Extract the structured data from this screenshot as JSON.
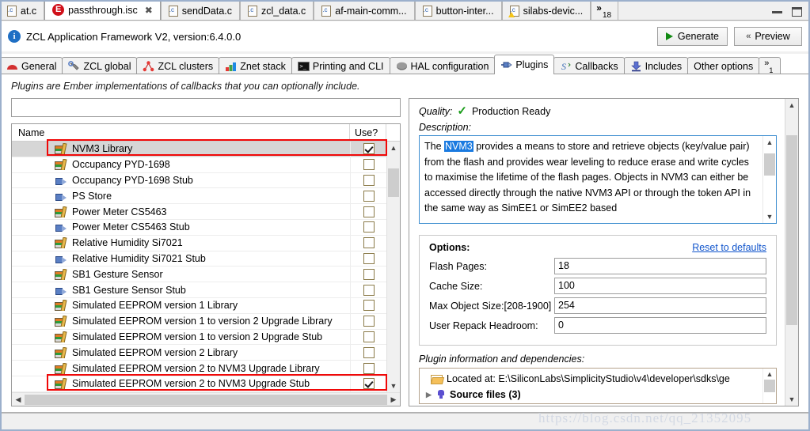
{
  "window": {
    "minimize_label": "minimize",
    "maximize_label": "maximize"
  },
  "editor_tabs": [
    {
      "label": "at.c",
      "icon": "c-file-icon",
      "active": false,
      "closable": false,
      "warn": false
    },
    {
      "label": "passthrough.isc",
      "icon": "ember-isc-icon",
      "active": true,
      "closable": true,
      "warn": false
    },
    {
      "label": "sendData.c",
      "icon": "c-file-icon",
      "active": false,
      "closable": false,
      "warn": false
    },
    {
      "label": "zcl_data.c",
      "icon": "c-file-icon",
      "active": false,
      "closable": false,
      "warn": false
    },
    {
      "label": "af-main-comm...",
      "icon": "c-file-icon",
      "active": false,
      "closable": false,
      "warn": false
    },
    {
      "label": "button-inter...",
      "icon": "c-file-icon",
      "active": false,
      "closable": false,
      "warn": false
    },
    {
      "label": "silabs-devic...",
      "icon": "c-file-warning-icon",
      "active": false,
      "closable": false,
      "warn": true
    }
  ],
  "editor_tabs_overflow": {
    "chevron": "»",
    "count": "18"
  },
  "header": {
    "icon": "info-icon",
    "title": "ZCL Application Framework V2, version:6.4.0.0",
    "generate_label": "Generate",
    "preview_label": "Preview"
  },
  "section_tabs": [
    {
      "label": "General",
      "icon": "red-semicircle-icon",
      "active": false
    },
    {
      "label": "ZCL global",
      "icon": "wrench-icon",
      "active": false
    },
    {
      "label": "ZCL clusters",
      "icon": "cluster-icon",
      "active": false
    },
    {
      "label": "Znet stack",
      "icon": "stack-icon",
      "active": false
    },
    {
      "label": "Printing and CLI",
      "icon": "console-icon",
      "active": false
    },
    {
      "label": "HAL configuration",
      "icon": "chip-icon",
      "active": false
    },
    {
      "label": "Plugins",
      "icon": "plugin-icon",
      "active": true
    },
    {
      "label": "Callbacks",
      "icon": "callback-icon",
      "active": false
    },
    {
      "label": "Includes",
      "icon": "includes-icon",
      "active": false
    },
    {
      "label": "Other options",
      "icon": "",
      "active": false
    }
  ],
  "section_tabs_overflow": {
    "chevron": "»",
    "count": "1"
  },
  "plugins_panel": {
    "intro": "Plugins are Ember implementations of callbacks that you can optionally include.",
    "filter_value": "",
    "filter_placeholder": "",
    "columns": {
      "name": "Name",
      "use": "Use?"
    },
    "rows": [
      {
        "name": "NVM3 Library",
        "icon": "library-icon",
        "checked": true,
        "selected": true,
        "highlighted": true
      },
      {
        "name": "Occupancy PYD-1698",
        "icon": "library-icon",
        "checked": false,
        "selected": false,
        "highlighted": false
      },
      {
        "name": "Occupancy PYD-1698 Stub",
        "icon": "stub-icon",
        "checked": false,
        "selected": false,
        "highlighted": false
      },
      {
        "name": "PS Store",
        "icon": "stub-icon",
        "checked": false,
        "selected": false,
        "highlighted": false
      },
      {
        "name": "Power Meter CS5463",
        "icon": "library-icon",
        "checked": false,
        "selected": false,
        "highlighted": false
      },
      {
        "name": "Power Meter CS5463 Stub",
        "icon": "stub-icon",
        "checked": false,
        "selected": false,
        "highlighted": false
      },
      {
        "name": "Relative Humidity Si7021",
        "icon": "library-icon",
        "checked": false,
        "selected": false,
        "highlighted": false
      },
      {
        "name": "Relative Humidity Si7021 Stub",
        "icon": "stub-icon",
        "checked": false,
        "selected": false,
        "highlighted": false
      },
      {
        "name": "SB1 Gesture Sensor",
        "icon": "library-icon",
        "checked": false,
        "selected": false,
        "highlighted": false
      },
      {
        "name": "SB1 Gesture Sensor Stub",
        "icon": "stub-icon",
        "checked": false,
        "selected": false,
        "highlighted": false
      },
      {
        "name": "Simulated EEPROM version 1 Library",
        "icon": "library-icon",
        "checked": false,
        "selected": false,
        "highlighted": false
      },
      {
        "name": "Simulated EEPROM version 1 to version 2 Upgrade Library",
        "icon": "library-icon",
        "checked": false,
        "selected": false,
        "highlighted": false
      },
      {
        "name": "Simulated EEPROM version 1 to version 2 Upgrade Stub",
        "icon": "library-icon",
        "checked": false,
        "selected": false,
        "highlighted": false
      },
      {
        "name": "Simulated EEPROM version 2 Library",
        "icon": "library-icon",
        "checked": false,
        "selected": false,
        "highlighted": false
      },
      {
        "name": "Simulated EEPROM version 2 to NVM3 Upgrade Library",
        "icon": "library-icon",
        "checked": false,
        "selected": false,
        "highlighted": false
      },
      {
        "name": "Simulated EEPROM version 2 to NVM3 Upgrade Stub",
        "icon": "library-icon",
        "checked": true,
        "selected": false,
        "highlighted": true
      }
    ]
  },
  "details_panel": {
    "quality_label": "Quality:",
    "quality_value": "Production Ready",
    "quality_icon": "green-check-icon",
    "description_label": "Description:",
    "description_prefix": "The ",
    "description_highlight": "NVM3",
    "description_rest": " provides a means to store and retrieve objects (key/value pair) from the flash and provides wear leveling to reduce erase and write cycles to maximise the lifetime of the flash pages. Objects in NVM3 can either be accessed directly through the native NVM3 API or through the token API in the same way as SimEE1 or SimEE2 based",
    "options_title": "Options:",
    "reset_label": "Reset to defaults",
    "options": [
      {
        "label": "Flash Pages:",
        "value": "18"
      },
      {
        "label": "Cache Size:",
        "value": "100"
      },
      {
        "label": "Max Object Size:[208-1900]",
        "value": "254"
      },
      {
        "label": "User Repack Headroom:",
        "value": "0"
      }
    ],
    "plugin_info_label": "Plugin information and dependencies:",
    "plugin_info_rows": [
      {
        "text": "Located at: E:\\SiliconLabs\\SimplicityStudio\\v4\\developer\\sdks\\ge",
        "icon": "folder-icon",
        "bold": false
      },
      {
        "text": "Source files (3)",
        "icon": "plug-purple-icon",
        "bold": true
      }
    ]
  },
  "watermark": "https://blog.csdn.net/qq_21352095",
  "colors": {
    "accent_blue": "#1a7ae0",
    "highlight_red": "#f00808",
    "link_blue": "#1155cc",
    "green_check": "#189c18",
    "selection_gray": "#d6d6d6"
  }
}
